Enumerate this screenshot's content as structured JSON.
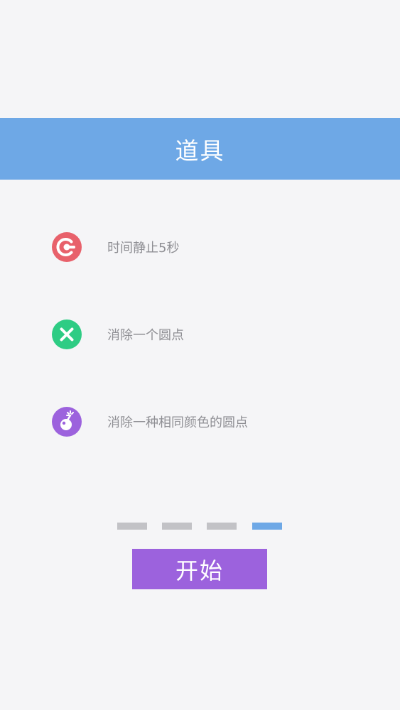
{
  "header": {
    "title": "道具"
  },
  "items": [
    {
      "icon": "clock-stop-icon",
      "color": "#e8616b",
      "label": "时间静止5秒"
    },
    {
      "icon": "close-x-icon",
      "color": "#2ecc84",
      "label": "消除一个圆点"
    },
    {
      "icon": "bomb-icon",
      "color": "#9c62dd",
      "label": "消除一种相同颜色的圆点"
    }
  ],
  "pager": {
    "count": 4,
    "active_index": 3,
    "active_color": "#6ea8e6",
    "inactive_color": "#c2c2c6"
  },
  "start_button": {
    "label": "开始",
    "color": "#9c62dd"
  }
}
